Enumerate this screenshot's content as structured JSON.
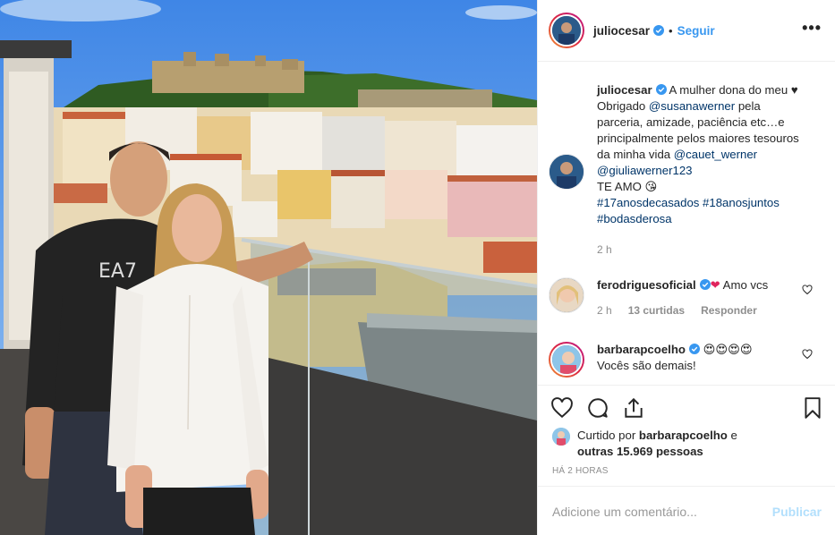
{
  "post": {
    "username": "juliocesar",
    "follow_label": "Seguir",
    "separator": "•",
    "more_label": "•••"
  },
  "caption": {
    "username": "juliocesar",
    "text_1": "A mulher dona do meu ♥",
    "text_2": "Obrigado ",
    "mention_1": "@susanawerner",
    "text_3": " pela parceria, amizade, paciência etc…e principalmente pelos maiores tesouros da minha vida ",
    "mention_2": "@cauet_werner",
    "mention_3": "@giuliawerner123",
    "text_4": "TE AMO 😘",
    "hashtags": "#17anosdecasados #18anosjuntos #bodasderosa",
    "time": "2 h"
  },
  "comments": [
    {
      "username": "ferodriguesoficial",
      "emoji": "❤",
      "text": "Amo vcs",
      "time": "2 h",
      "likes": "13 curtidas",
      "reply_label": "Responder"
    },
    {
      "username": "barbarapcoelho",
      "text": "😍😍😍😍",
      "text_2": "Vocês são demais!"
    }
  ],
  "likes": {
    "prefix": "Curtido por ",
    "user": "barbarapcoelho",
    "middle": " e",
    "others": "outras 15.969 pessoas"
  },
  "timestamp": "HÁ 2 HORAS",
  "comment_box": {
    "placeholder": "Adicione um comentário...",
    "publish_label": "Publicar"
  },
  "colors": {
    "link": "#3897f0",
    "mention": "#003569",
    "publish_disabled": "#b2dffc"
  },
  "icons": [
    "heart-icon",
    "comment-icon",
    "share-icon",
    "bookmark-icon",
    "verified-icon",
    "more-icon"
  ]
}
